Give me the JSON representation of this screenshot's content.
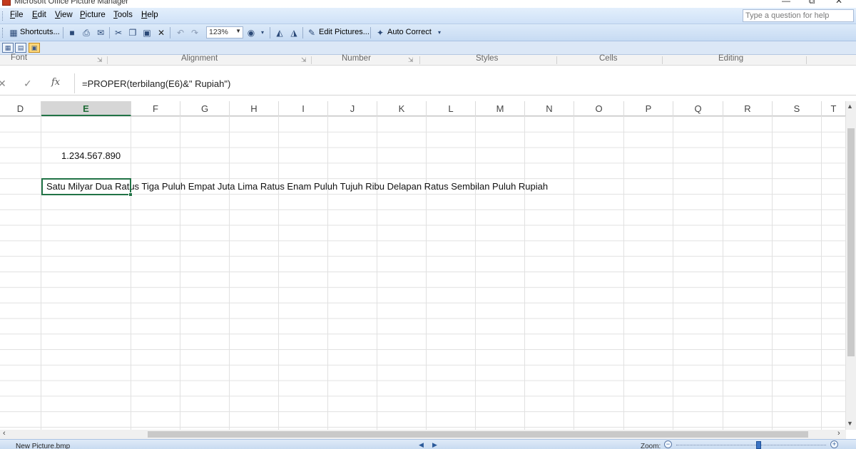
{
  "window": {
    "title": "Microsoft Office Picture Manager",
    "buttons": [
      "—",
      "⧉",
      "✕"
    ]
  },
  "menubar": {
    "items": [
      {
        "label": "File",
        "u": "F"
      },
      {
        "label": "Edit",
        "u": "E"
      },
      {
        "label": "View",
        "u": "V"
      },
      {
        "label": "Picture",
        "u": "P"
      },
      {
        "label": "Tools",
        "u": "T"
      },
      {
        "label": "Help",
        "u": "H"
      }
    ],
    "question_placeholder": "Type a question for help"
  },
  "toolbar": {
    "shortcuts_label": "Shortcuts...",
    "zoom_value": "123%",
    "edit_pictures_label": "Edit Pictures...",
    "auto_correct_label": "Auto Correct"
  },
  "ribbon": {
    "groups": [
      "Font",
      "Alignment",
      "Number",
      "Styles",
      "Cells",
      "Editing"
    ]
  },
  "formula_bar": {
    "cancel_glyph": "✕",
    "enter_glyph": "✓",
    "fx_label": "fx",
    "formula": "=PROPER(terbilang(E6)&\" Rupiah\")"
  },
  "sheet": {
    "columns": [
      "D",
      "E",
      "F",
      "G",
      "H",
      "I",
      "J",
      "K",
      "L",
      "M",
      "N",
      "O",
      "P",
      "Q",
      "R",
      "S",
      "T"
    ],
    "selected_column": "E",
    "number_cell": "1.234.567.890",
    "result_cell": "Satu Milyar Dua Ratus Tiga Puluh Empat Juta Lima Ratus Enam Puluh Tujuh Ribu Delapan Ratus Sembilan Puluh Rupiah"
  },
  "statusbar": {
    "filename": "New Picture.bmp",
    "zoom_label": "Zoom:"
  }
}
